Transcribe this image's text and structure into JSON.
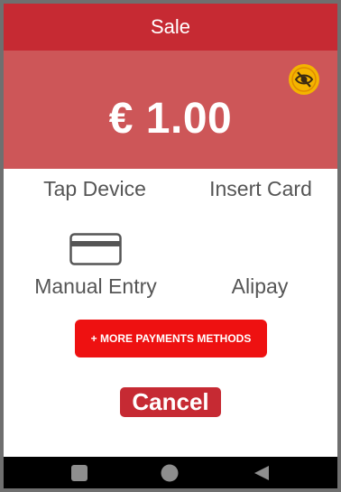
{
  "header": {
    "title": "Sale"
  },
  "amount_panel": {
    "amount": "€ 1.00",
    "privacy_icon": "eye-slash-icon"
  },
  "payment_methods": {
    "tap": "Tap Device",
    "insert": "Insert Card",
    "manual": "Manual Entry",
    "alipay": "Alipay",
    "manual_icon": "credit-card-icon"
  },
  "actions": {
    "more": "+ MORE PAYMENTS METHODS",
    "cancel": "Cancel"
  },
  "nav": {
    "recents_icon": "square-icon",
    "home_icon": "circle-icon",
    "back_icon": "triangle-back-icon"
  },
  "colors": {
    "header": "#c62a33",
    "amount_bg": "#cd5658",
    "more_button": "#ee1111",
    "cancel_button": "#c62a33",
    "privacy_icon_bg": "#f4b400"
  }
}
